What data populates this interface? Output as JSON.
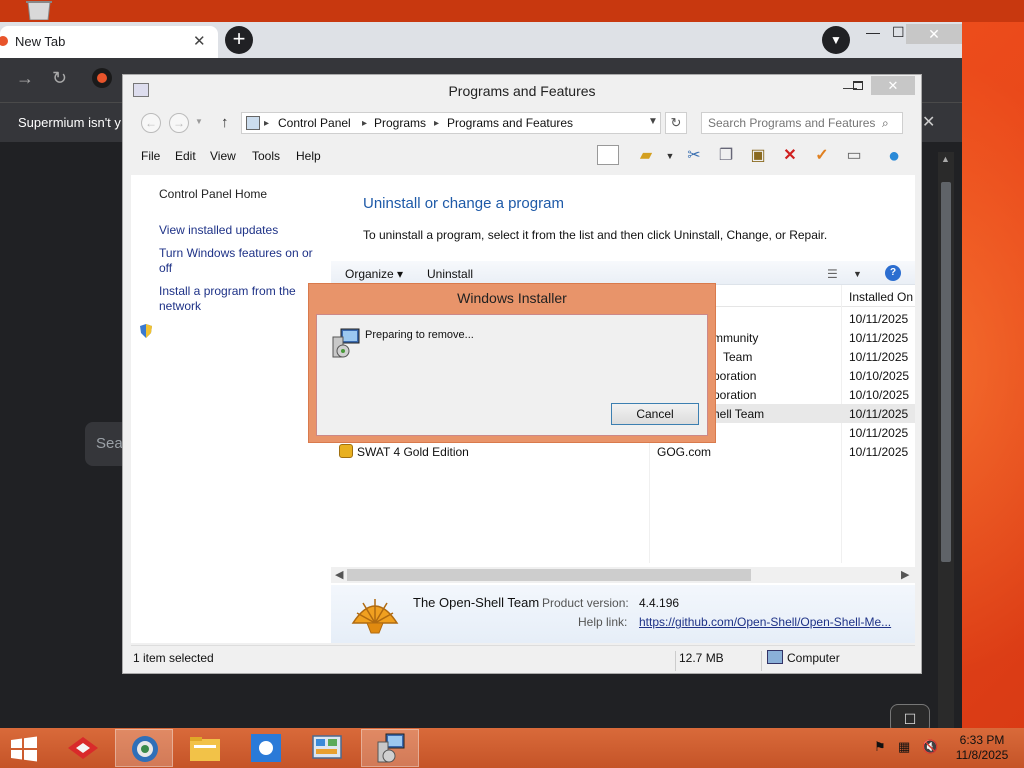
{
  "browser": {
    "tab_title": "New Tab",
    "tab_close": "✕",
    "new_tab": "+",
    "window_min": "—",
    "window_max": "☐",
    "window_close": "✕",
    "infobar_text": "Supermium isn't y",
    "infobar_close": "✕",
    "search_placeholder": "Sea"
  },
  "cp": {
    "title": "Programs and Features",
    "breadcrumb": [
      "Control Panel",
      "Programs",
      "Programs and Features"
    ],
    "search_placeholder": "Search Programs and Features",
    "menu": [
      "File",
      "Edit",
      "View",
      "Tools",
      "Help"
    ],
    "sidebar": {
      "home": "Control Panel Home",
      "updates": "View installed updates",
      "features_line1": "Turn Windows features on or",
      "features_line2": "off",
      "network_line1": "Install a program from the",
      "network_line2": "network"
    },
    "heading": "Uninstall or change a program",
    "description": "To uninstall a program, select it from the list and then click Uninstall, Change, or Repair.",
    "cmd": {
      "organize": "Organize ▾",
      "uninstall": "Uninstall"
    },
    "col_installed": "Installed On",
    "rows": [
      {
        "name": "",
        "publisher": "",
        "date": "10/11/2025"
      },
      {
        "name": "",
        "publisher": "mmunity",
        "date": "10/11/2025"
      },
      {
        "name": "",
        "publisher": "Team",
        "date": "10/11/2025"
      },
      {
        "name": "",
        "publisher": "poration",
        "date": "10/10/2025"
      },
      {
        "name": "",
        "publisher": "poration",
        "date": "10/10/2025"
      },
      {
        "name": "",
        "publisher": "hell Team",
        "date": "10/11/2025"
      },
      {
        "name": "",
        "publisher": "",
        "date": "10/11/2025"
      },
      {
        "name": "SWAT 4 Gold Edition",
        "publisher": "GOG.com",
        "date": "10/11/2025"
      }
    ],
    "details": {
      "name": "The Open-Shell Team",
      "version_label": "Product version:",
      "version": "4.4.196",
      "help_label": "Help link:",
      "help_link": "https://github.com/Open-Shell/Open-Shell-Me..."
    },
    "status": {
      "selected": "1 item selected",
      "size": "12.7 MB",
      "location": "Computer"
    }
  },
  "dialog": {
    "title": "Windows Installer",
    "message": "Preparing to remove...",
    "cancel": "Cancel"
  },
  "taskbar": {
    "time": "6:33 PM",
    "date": "11/8/2025"
  }
}
